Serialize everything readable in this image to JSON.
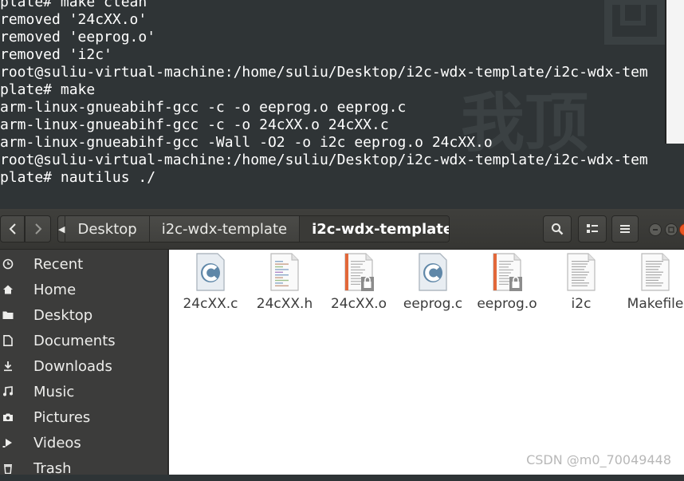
{
  "terminal": {
    "lines": [
      "plate# make clean",
      "removed '24cXX.o'",
      "removed 'eeprog.o'",
      "removed 'i2c'",
      "root@suliu-virtual-machine:/home/suliu/Desktop/i2c-wdx-template/i2c-wdx-tem",
      "plate# make",
      "arm-linux-gnueabihf-gcc -c -o eeprog.o eeprog.c",
      "arm-linux-gnueabihf-gcc -c -o 24cXX.o 24cXX.c",
      "arm-linux-gnueabihf-gcc -Wall -O2 -o i2c eeprog.o 24cXX.o",
      "root@suliu-virtual-machine:/home/suliu/Desktop/i2c-wdx-template/i2c-wdx-tem",
      "plate# nautilus ./"
    ],
    "wallpaper_text": "我顶",
    "colors": {
      "background": "#2f3436",
      "text": "#ffffff"
    }
  },
  "nautilus": {
    "breadcrumbs": [
      {
        "label": "Desktop",
        "active": false
      },
      {
        "label": "i2c-wdx-template",
        "active": false
      },
      {
        "label": "i2c-wdx-template",
        "active": true
      }
    ],
    "icons": {
      "back": "chevron-left-icon",
      "forward": "chevron-right-icon",
      "search": "search-icon",
      "view_mode": "view-grid-icon",
      "menu": "hamburger-menu-icon"
    },
    "sidebar": [
      {
        "label": "Recent",
        "icon": "clock-icon"
      },
      {
        "label": "Home",
        "icon": "home-icon"
      },
      {
        "label": "Desktop",
        "icon": "folder-icon"
      },
      {
        "label": "Documents",
        "icon": "document-icon"
      },
      {
        "label": "Downloads",
        "icon": "download-icon"
      },
      {
        "label": "Music",
        "icon": "music-icon"
      },
      {
        "label": "Pictures",
        "icon": "camera-icon"
      },
      {
        "label": "Videos",
        "icon": "video-icon"
      },
      {
        "label": "Trash",
        "icon": "trash-icon"
      }
    ],
    "files": [
      {
        "name": "24cXX.c",
        "type": "c-source"
      },
      {
        "name": "24cXX.h",
        "type": "c-header"
      },
      {
        "name": "24cXX.o",
        "type": "object-locked"
      },
      {
        "name": "eeprog.c",
        "type": "c-source"
      },
      {
        "name": "eeprog.o",
        "type": "object-locked"
      },
      {
        "name": "i2c",
        "type": "text"
      },
      {
        "name": "Makefile",
        "type": "text"
      }
    ],
    "colors": {
      "headerbar": "#3f3f3c",
      "sidebar": "#3c3c3b",
      "accent_close": "#e95420"
    }
  },
  "watermark": "CSDN @m0_70049448"
}
